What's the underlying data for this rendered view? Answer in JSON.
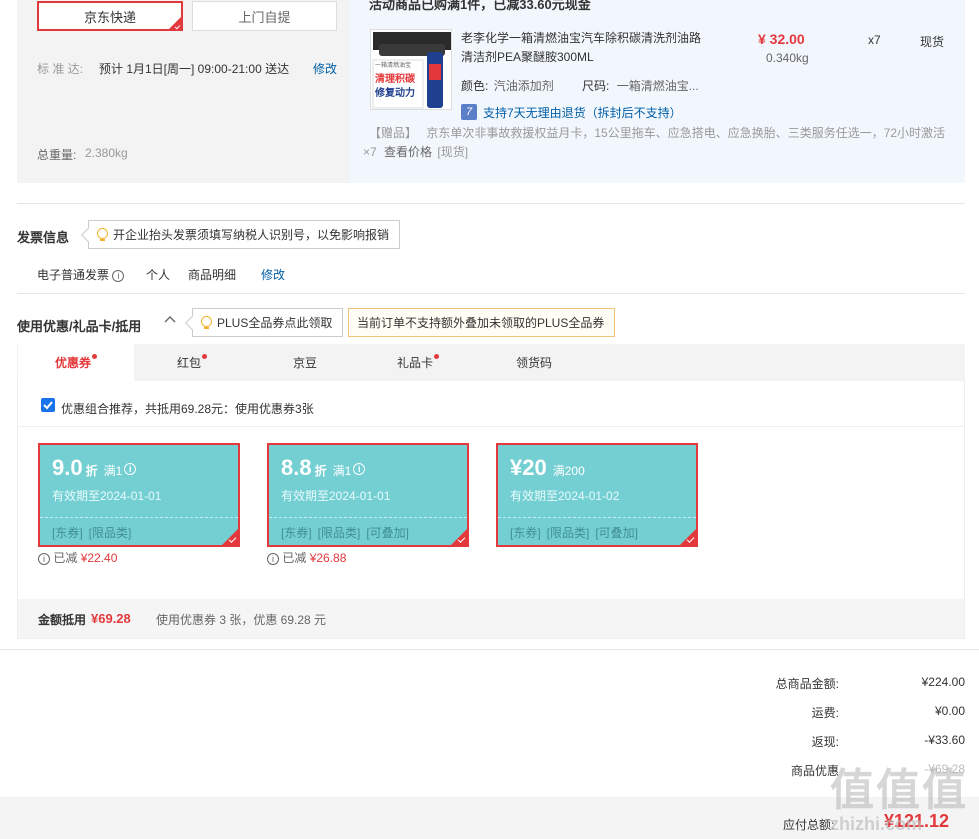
{
  "shipping": {
    "options": [
      {
        "label": "京东快递",
        "selected": true
      },
      {
        "label": "上门自提",
        "selected": false
      }
    ],
    "eta_label": "标 准 达:",
    "eta_value": "预计 1月1日[周一] 09:00-21:00 送达",
    "modify_label": "修改",
    "weight_label": "总重量:",
    "weight_value": "2.380kg"
  },
  "product_group": {
    "promo_text": "活动商品已购满1件，已减33.60元现金",
    "product": {
      "name_line1": "老李化学一箱清燃油宝汽车除积碳清洗剂油路",
      "name_line2": "清洁剂PEA聚醚胺300ML",
      "price": "¥ 32.00",
      "weight": "0.340kg",
      "quantity": "x7",
      "stock": "现货",
      "color_label": "颜色:",
      "color_value": "汽油添加剂",
      "size_label": "尺码:",
      "size_value": "一箱清燃油宝...",
      "return_icon_text": "7",
      "return_policy": "支持7天无理由退货（拆封后不支持）",
      "gift_tag": "【赠品】",
      "gift_text": "京东单次非事故救援权益月卡，15公里拖车、应急搭电、应急换胎、三类服务任选一，72小时激活",
      "gift_qty": "×7",
      "gift_link": "查看价格",
      "gift_stock": "[现货]",
      "image_text_top": "一箱清燃油宝",
      "image_text_main1": "清理积碳",
      "image_text_main2": "修复动力"
    }
  },
  "invoice": {
    "title": "发票信息",
    "tip": "开企业抬头发票须填写纳税人识别号，以免影响报销",
    "type": "电子普通发票",
    "info_icon": "i",
    "holder": "个人",
    "content": "商品明细",
    "modify_label": "修改"
  },
  "discount": {
    "title": "使用优惠/礼品卡/抵用",
    "plus_tip": "PLUS全品券点此领取",
    "warn_tip": "当前订单不支持额外叠加未领取的PLUS全品券",
    "tabs": [
      {
        "label": "优惠券",
        "dot": true,
        "active": true
      },
      {
        "label": "红包",
        "dot": true,
        "active": false
      },
      {
        "label": "京豆",
        "dot": false,
        "active": false
      },
      {
        "label": "礼品卡",
        "dot": true,
        "active": false
      },
      {
        "label": "领货码",
        "dot": false,
        "active": false
      }
    ],
    "combo_checked": true,
    "combo_text": "优惠组合推荐，共抵用69.28元：使用优惠券3张",
    "coupons": [
      {
        "value": "9.0",
        "unit": "折",
        "cond": "满1",
        "has_info": true,
        "expire": "有效期至2024-01-01",
        "tags": [
          "[东券]",
          "[限品类]"
        ],
        "saved_label": "已减",
        "saved": "¥22.40"
      },
      {
        "value": "8.8",
        "unit": "折",
        "cond": "满1",
        "has_info": true,
        "expire": "有效期至2024-01-01",
        "tags": [
          "[东券]",
          "[限品类]",
          "[可叠加]"
        ],
        "saved_label": "已减",
        "saved": "¥26.88"
      },
      {
        "value": "¥20",
        "unit": "",
        "cond": "满200",
        "has_info": false,
        "expire": "有效期至2024-01-02",
        "tags": [
          "[东券]",
          "[限品类]",
          "[可叠加]"
        ],
        "saved_label": "",
        "saved": ""
      }
    ],
    "summary_label": "金额抵用",
    "summary_value": "¥69.28",
    "summary_text": "使用优惠券 3 张，优惠 69.28 元"
  },
  "totals": {
    "rows": [
      {
        "label": "总商品金额:",
        "value": "¥224.00"
      },
      {
        "label": "运费:",
        "value": "¥0.00"
      },
      {
        "label": "返现:",
        "value": "-¥33.60"
      },
      {
        "label": "商品优惠",
        "value": "-¥69.28"
      }
    ],
    "payable_label": "应付总额:",
    "payable_value": "¥121.12"
  },
  "watermark": {
    "text": "值值值",
    "url": "zhizhi.com"
  },
  "colors": {
    "accent": "#e4393c",
    "coupon": "#74cfd3",
    "link": "#005ea7"
  }
}
